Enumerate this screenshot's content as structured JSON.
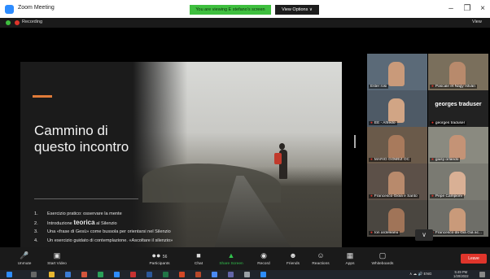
{
  "window": {
    "title": "Zoom Meeting",
    "share_banner": "You are viewing E stefano's screen",
    "view_options": "View Options ∨",
    "minimize": "–",
    "restore": "❐",
    "close": "×"
  },
  "status_bar": {
    "recording": "Recording",
    "view": "View"
  },
  "slide": {
    "title": "Cammino di questo incontro",
    "bullets": [
      {
        "num": "1.",
        "pre": "Esercizio pratico: osservare la mente",
        "em": "",
        "post": ""
      },
      {
        "num": "2.",
        "pre": "Introduzione ",
        "em": "teorica",
        "post": " al Silenzio"
      },
      {
        "num": "3.",
        "pre": "Una «frase di Gesù» come bussola per orientarsi nel Silenzio",
        "em": "",
        "post": ""
      },
      {
        "num": "4.",
        "pre": "Un esercizio guidato di contemplazione. «Ascoltare il silenzio»",
        "em": "",
        "post": ""
      }
    ]
  },
  "gallery": {
    "participants": [
      {
        "name": "Ester rosi",
        "active": true
      },
      {
        "name": "Pascale et Nagy István",
        "active": false
      },
      {
        "name": "EE - Alfredo",
        "active": false
      },
      {
        "name": "georges traduser",
        "active": false,
        "center_name": "georges traduser"
      },
      {
        "name": "MARIO GOMEZ OC",
        "active": false
      },
      {
        "name": "giusy orlando",
        "active": false
      },
      {
        "name": "Francesco Gioia e Santo",
        "active": false
      },
      {
        "name": "Pepe Campioni",
        "active": false
      },
      {
        "name": "Ion ardeleanu",
        "active": false
      },
      {
        "name": "Francesco da Già Già ac...",
        "active": false
      }
    ],
    "more_chevron": "∨"
  },
  "toolbar": {
    "unmute": "Unmute",
    "start_video": "Start Video",
    "participants": "Participants",
    "participants_count": "56",
    "chat": "Chat",
    "share_screen": "Share Screen",
    "record": "Record",
    "friends": "Friends",
    "reactions": "Reactions",
    "apps": "Apps",
    "whiteboards": "Whiteboards",
    "leave": "Leave"
  },
  "taskbar": {
    "tray": "∧  ☁  🔊  ENG",
    "time": "5:49 PM",
    "date": "1/20/2022"
  }
}
